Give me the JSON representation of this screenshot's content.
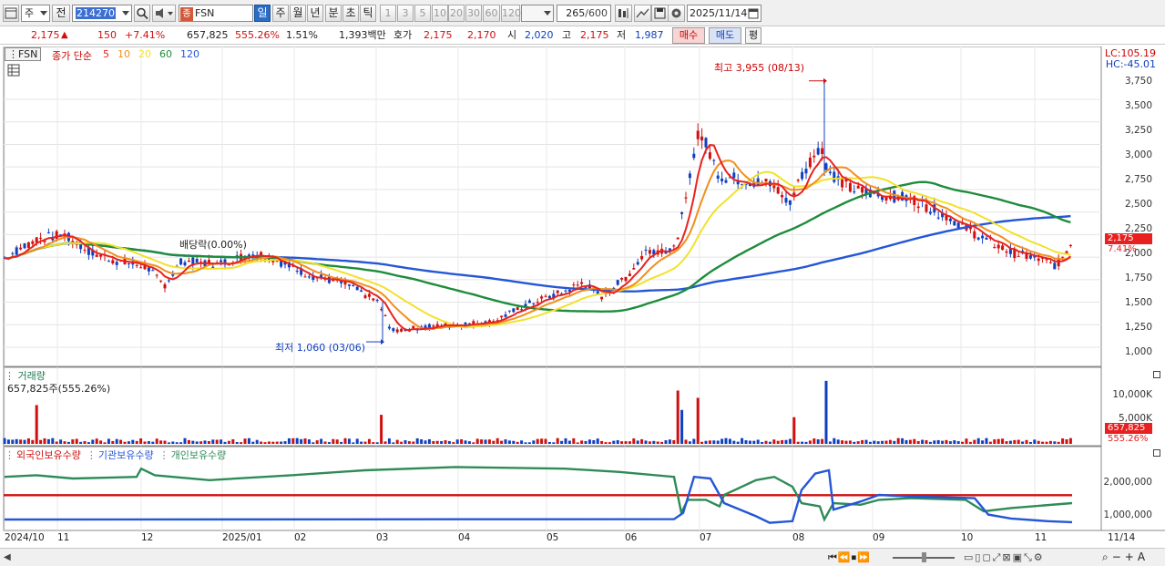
{
  "toolbar": {
    "period_unit": "주",
    "prev_label": "전",
    "code": "214270",
    "name_prefix": "종",
    "name": "FSN",
    "periods": [
      "일",
      "주",
      "월",
      "년",
      "분",
      "초",
      "틱"
    ],
    "active_period": "일",
    "intervals": [
      "1",
      "3",
      "5",
      "10",
      "20",
      "30",
      "60",
      "120"
    ],
    "count": "265",
    "count_max": "/600",
    "date": "2025/11/14"
  },
  "quote": {
    "price": "2,175",
    "change_arrow": "▲",
    "change": "150",
    "change_pct": "+7.41%",
    "volume": "657,825",
    "volume_ratio": "555.26%",
    "turnover": "1.51%",
    "amount": "1,393백만",
    "bid_ask_label": "호가",
    "ask": "2,175",
    "bid": "2,170",
    "open_label": "시",
    "open": "2,020",
    "high_label": "고",
    "high": "2,175",
    "low_label": "저",
    "low": "1,987",
    "buy_label": "매수",
    "sell_label": "매도",
    "avg_label": "평"
  },
  "price_panel": {
    "symbol": "FSN",
    "ma_label": "종가 단순",
    "ma_periods": [
      {
        "label": "5",
        "color": "#e8231f"
      },
      {
        "label": "10",
        "color": "#f18f1d"
      },
      {
        "label": "20",
        "color": "#f2e12b"
      },
      {
        "label": "60",
        "color": "#1e8c3b"
      },
      {
        "label": "120",
        "color": "#2456d6"
      }
    ],
    "lc_label": "LC:105.19",
    "hc_label": "HC:-45.01",
    "high_annotation": "최고 3,955 (08/13)",
    "low_annotation": "최저 1,060 (03/06)",
    "dividend_annotation": "배당락(0.00%)",
    "current_price_tag": "2,175",
    "current_pct_tag": "7.41%",
    "y_ticks": [
      "3,750",
      "3,500",
      "3,250",
      "3,000",
      "2,750",
      "2,500",
      "2,250",
      "2,000",
      "1,750",
      "1,500",
      "1,250",
      "1,000"
    ]
  },
  "volume_panel": {
    "title": "거래량",
    "value_label": "657,825주(555.26%)",
    "y_ticks": [
      "10,000K",
      "5,000K"
    ],
    "current_tag": "657,825",
    "current_pct_tag": "555.26%"
  },
  "holding_panel": {
    "legend": [
      {
        "label": "외국인보유수량",
        "color": "#d01010"
      },
      {
        "label": "기관보유수량",
        "color": "#2456d6"
      },
      {
        "label": "개인보유수량",
        "color": "#2e8b57"
      }
    ],
    "y_ticks": [
      "2,000,000",
      "1,000,000"
    ]
  },
  "x_axis": {
    "labels": [
      "2024/10",
      "11",
      "12",
      "2025/01",
      "02",
      "03",
      "04",
      "05",
      "06",
      "07",
      "08",
      "09",
      "10",
      "11"
    ],
    "end_label": "11/14"
  },
  "colors": {
    "up": "#d01010",
    "down": "#1040c0",
    "ma5": "#e8231f",
    "ma10": "#f18f1d",
    "ma20": "#f2e12b",
    "ma60": "#1e8c3b",
    "ma120": "#2456d6"
  }
}
